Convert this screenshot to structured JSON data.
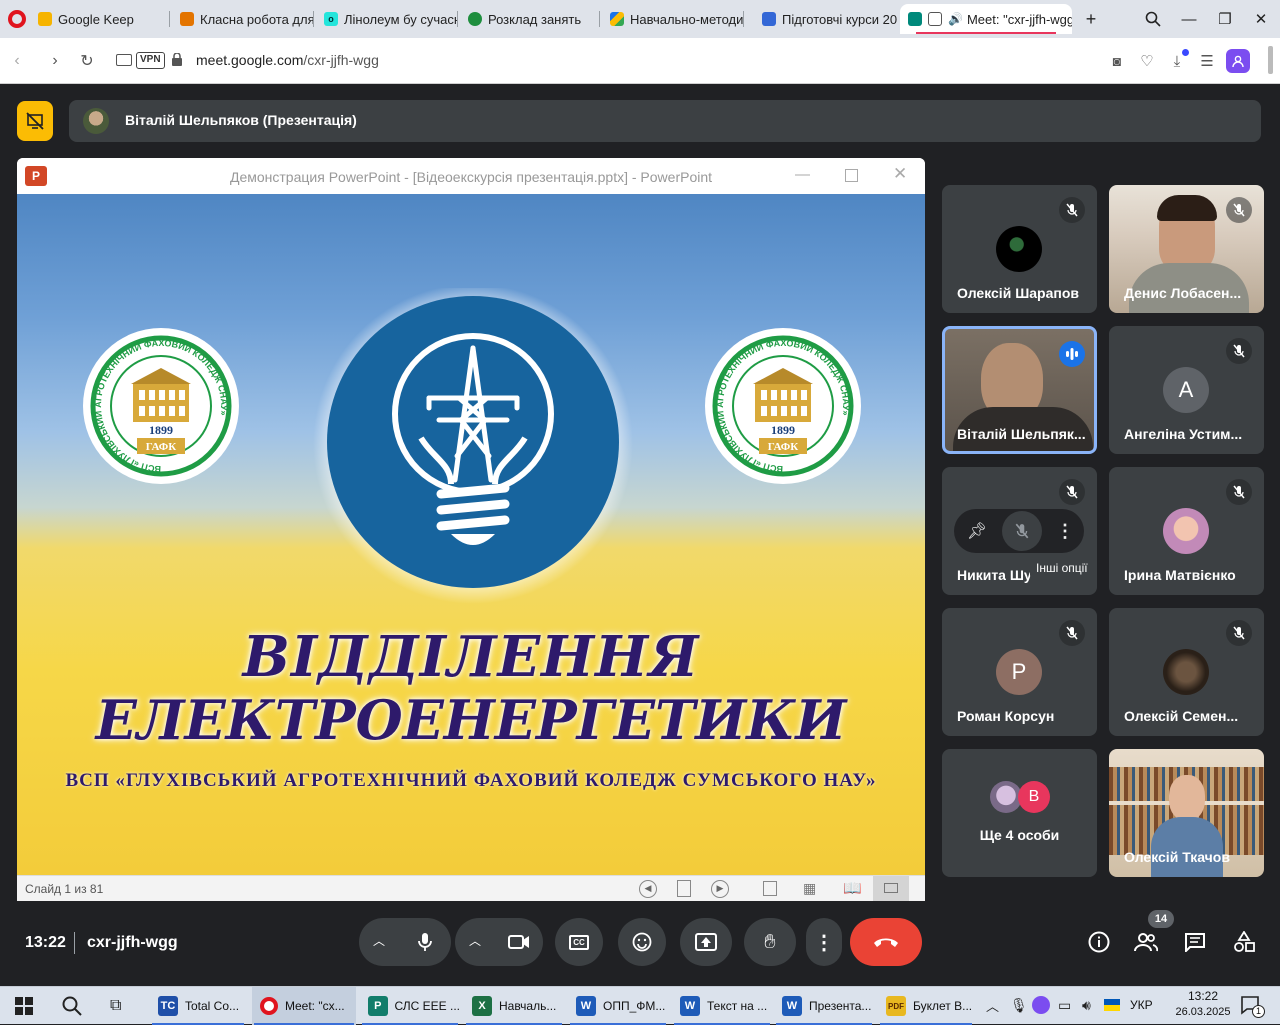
{
  "browser": {
    "tabs": [
      {
        "label": "Google Keep",
        "icon": "google-keep-icon",
        "color": "#f6b400"
      },
      {
        "label": "Класна робота для к",
        "icon": "classroom-icon",
        "color": "#e37400"
      },
      {
        "label": "Лінолеум бу сучасн",
        "icon": "olx-icon",
        "color": "#23e5db"
      },
      {
        "label": "Розклад занять",
        "icon": "schedule-icon",
        "color": "#1e8e3e"
      },
      {
        "label": "Навчально-методич",
        "icon": "google-drive-icon",
        "color": "#1a73e8"
      },
      {
        "label": "Підготовчі курси 20:",
        "icon": "google-forms-icon",
        "color": "#3367d6"
      },
      {
        "label": "Meet: \"cxr-jjfh-wgg",
        "icon": "google-meet-icon",
        "color": "#00897b"
      }
    ],
    "url_host": "meet.google.com",
    "url_path": "/cxr-jjfh-wgg",
    "vpn_label": "VPN"
  },
  "meet": {
    "presenter_label": "Віталій Шельпяков (Презентація)",
    "ppt": {
      "window_title": "Демонстрация PowerPoint - [Відеоекскурсія презентація.pptx] - PowerPoint",
      "slide_status": "Слайд 1 из 81",
      "slide_line1": "ВІДДІЛЕННЯ",
      "slide_line2": "ЕЛЕКТРОЕНЕРГЕТИКИ",
      "slide_subtitle": "ВСП «ГЛУХІВСЬКИЙ АГРОТЕХНІЧНИЙ ФАХОВИЙ КОЛЕДЖ СУМСЬКОГО НАУ»",
      "seal_ring_text": "ВСП «ГЛУХІВСЬКИЙ АГРОТЕХНІЧНИЙ ФАХОВИЙ КОЛЕДЖ СНАУ»",
      "seal_year": "1899",
      "seal_abbr": "ГАФК"
    },
    "participants": [
      {
        "name": "Олексій Шарапов",
        "kind": "avatar-img",
        "color": "#1b1b1b"
      },
      {
        "name": "Денис Лобасен...",
        "kind": "video",
        "color": "#c9b7a3"
      },
      {
        "name": "Віталій Шельпяк...",
        "kind": "video-speaking",
        "color": "#6b6258"
      },
      {
        "name": "Ангеліна Устим...",
        "kind": "letter",
        "letter": "А",
        "color": "#5f6368"
      },
      {
        "name": "Никита Шу",
        "kind": "hover",
        "color": "#3c4043"
      },
      {
        "name": "Ірина Матвієнко",
        "kind": "avatar-img",
        "color": "#d8a0c8"
      },
      {
        "name": "Роман Корсун",
        "kind": "letter",
        "letter": "Р",
        "color": "#8d6e63"
      },
      {
        "name": "Олексій Семен...",
        "kind": "avatar-img",
        "color": "#4a3a2a"
      },
      {
        "name": "Ще 4 особи",
        "kind": "more",
        "letter": "В",
        "color": "#e8365d"
      },
      {
        "name": "Олексій Ткачов",
        "kind": "video",
        "color": "#b58a5a"
      }
    ],
    "tooltip": "Інші опції",
    "time": "13:22",
    "meeting_code": "cxr-jjfh-wgg",
    "people_count": "14"
  },
  "taskbar": {
    "items": [
      {
        "label": "Total Co...",
        "color": "#1f4fa8",
        "glyph": "TC"
      },
      {
        "label": "Meet: \"cx...",
        "color": "#e0141e",
        "glyph": "O"
      },
      {
        "label": "СЛС EEE ...",
        "color": "#127d6b",
        "glyph": "P"
      },
      {
        "label": "Навчаль...",
        "color": "#1d7044",
        "glyph": "X"
      },
      {
        "label": "ОПП_ФМ...",
        "color": "#1e5bb8",
        "glyph": "W"
      },
      {
        "label": "Текст на ...",
        "color": "#1e5bb8",
        "glyph": "W"
      },
      {
        "label": "Презента...",
        "color": "#1e5bb8",
        "glyph": "W"
      },
      {
        "label": "Буклет В...",
        "color": "#5a4a1a",
        "glyph": "PDF"
      }
    ],
    "lang": "УКР",
    "clock_time": "13:22",
    "clock_date": "26.03.2025",
    "notif_count": "1"
  }
}
